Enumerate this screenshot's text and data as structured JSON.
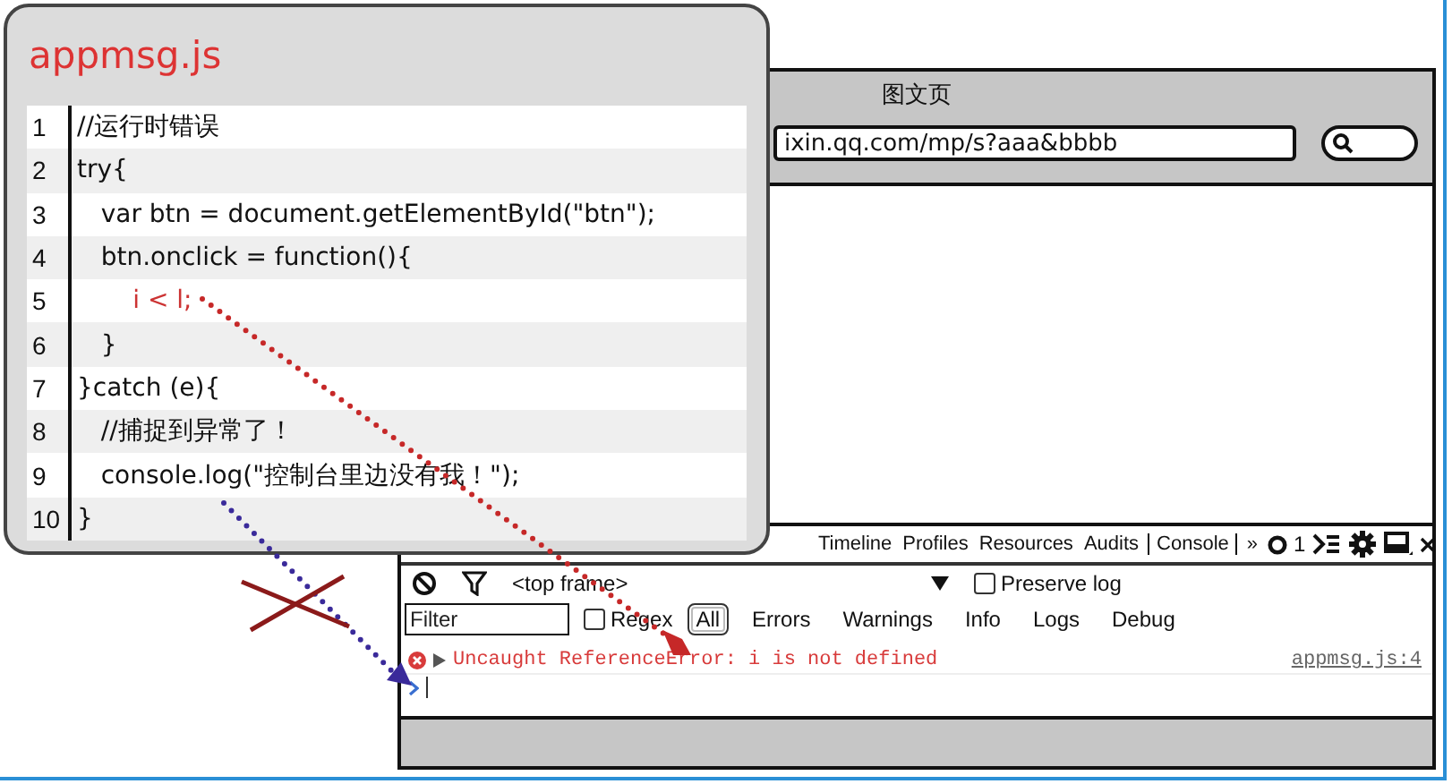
{
  "code_panel": {
    "title": "appmsg.js",
    "lines": [
      {
        "number": "1",
        "code": "//运行时错误",
        "kind": "normal"
      },
      {
        "number": "2",
        "code": "try{",
        "kind": "normal"
      },
      {
        "number": "3",
        "code": "   var btn = document.getElementById(\"btn\");",
        "kind": "normal"
      },
      {
        "number": "4",
        "code": "   btn.onclick = function(){",
        "kind": "normal"
      },
      {
        "number": "5",
        "code": "       i < l;",
        "kind": "error"
      },
      {
        "number": "6",
        "code": "   }",
        "kind": "normal"
      },
      {
        "number": "7",
        "code": "}catch (e){",
        "kind": "normal"
      },
      {
        "number": "8",
        "code": "   //捕捉到异常了！",
        "kind": "normal"
      },
      {
        "number": "9",
        "code": "   console.log(\"控制台里边没有我！\");",
        "kind": "normal"
      },
      {
        "number": "10",
        "code": "}",
        "kind": "normal"
      }
    ]
  },
  "browser": {
    "title": "图文页",
    "url": "ixin.qq.com/mp/s?aaa&bbbb"
  },
  "devtools": {
    "tabs": [
      {
        "label": "Timeline",
        "selected": false
      },
      {
        "label": "Profiles",
        "selected": false
      },
      {
        "label": "Resources",
        "selected": false
      },
      {
        "label": "Audits",
        "selected": false
      },
      {
        "label": "Console",
        "selected": true
      }
    ],
    "more": "»",
    "error_count": "1",
    "frame": "<top frame>",
    "preserve_log": {
      "label": "Preserve log",
      "checked": false
    },
    "filter": {
      "placeholder": "Filter"
    },
    "regex": {
      "label": "Regex",
      "checked": false
    },
    "levels": [
      {
        "label": "All",
        "selected": true
      },
      {
        "label": "Errors",
        "selected": false
      },
      {
        "label": "Warnings",
        "selected": false
      },
      {
        "label": "Info",
        "selected": false
      },
      {
        "label": "Logs",
        "selected": false
      },
      {
        "label": "Debug",
        "selected": false
      }
    ],
    "messages": [
      {
        "kind": "error",
        "text": "Uncaught ReferenceError: i is not defined",
        "source": "appmsg.js:4"
      }
    ]
  }
}
